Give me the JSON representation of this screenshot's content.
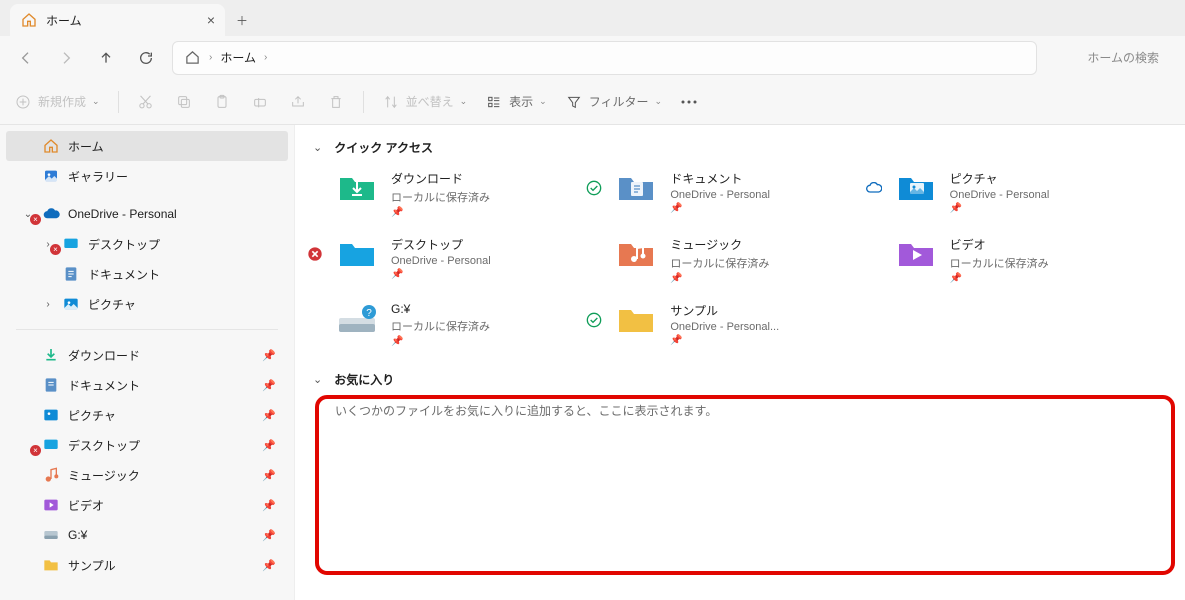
{
  "tab": {
    "title": "ホーム"
  },
  "addr": {
    "home_icon": "home",
    "label": "ホーム"
  },
  "search": {
    "placeholder": "ホームの検索"
  },
  "toolbar": {
    "new": "新規作成",
    "sort": "並べ替え",
    "view": "表示",
    "filter": "フィルター"
  },
  "sidebar": {
    "home": "ホーム",
    "gallery": "ギャラリー",
    "onedrive": "OneDrive - Personal",
    "od_children": [
      "デスクトップ",
      "ドキュメント",
      "ピクチャ"
    ],
    "pins": [
      "ダウンロード",
      "ドキュメント",
      "ピクチャ",
      "デスクトップ",
      "ミュージック",
      "ビデオ",
      "G:¥",
      "サンプル"
    ]
  },
  "sections": {
    "quick": "クイック アクセス",
    "favorites": "お気に入り",
    "fav_msg": "いくつかのファイルをお気に入りに追加すると、ここに表示されます。"
  },
  "quick_items": [
    {
      "name": "ダウンロード",
      "sub": "ローカルに保存済み",
      "color": "#1db98a",
      "type": "download",
      "status": ""
    },
    {
      "name": "ドキュメント",
      "sub": "OneDrive - Personal",
      "color": "#5a90c7",
      "type": "doc",
      "status": "sync"
    },
    {
      "name": "ピクチャ",
      "sub": "OneDrive - Personal",
      "color": "#0f8bd6",
      "type": "pic",
      "status": "cloud"
    },
    {
      "name": "デスクトップ",
      "sub": "OneDrive - Personal",
      "color": "#17a3e0",
      "type": "desktop",
      "status": "error"
    },
    {
      "name": "ミュージック",
      "sub": "ローカルに保存済み",
      "color": "#e67851",
      "type": "music",
      "status": ""
    },
    {
      "name": "ビデオ",
      "sub": "ローカルに保存済み",
      "color": "#a259d9",
      "type": "video",
      "status": ""
    },
    {
      "name": "G:¥",
      "sub": "ローカルに保存済み",
      "color": "#b7c6d0",
      "type": "drive",
      "status": ""
    },
    {
      "name": "サンプル",
      "sub": "OneDrive - Personal...",
      "color": "#f2c043",
      "type": "folder",
      "status": "sync"
    }
  ]
}
